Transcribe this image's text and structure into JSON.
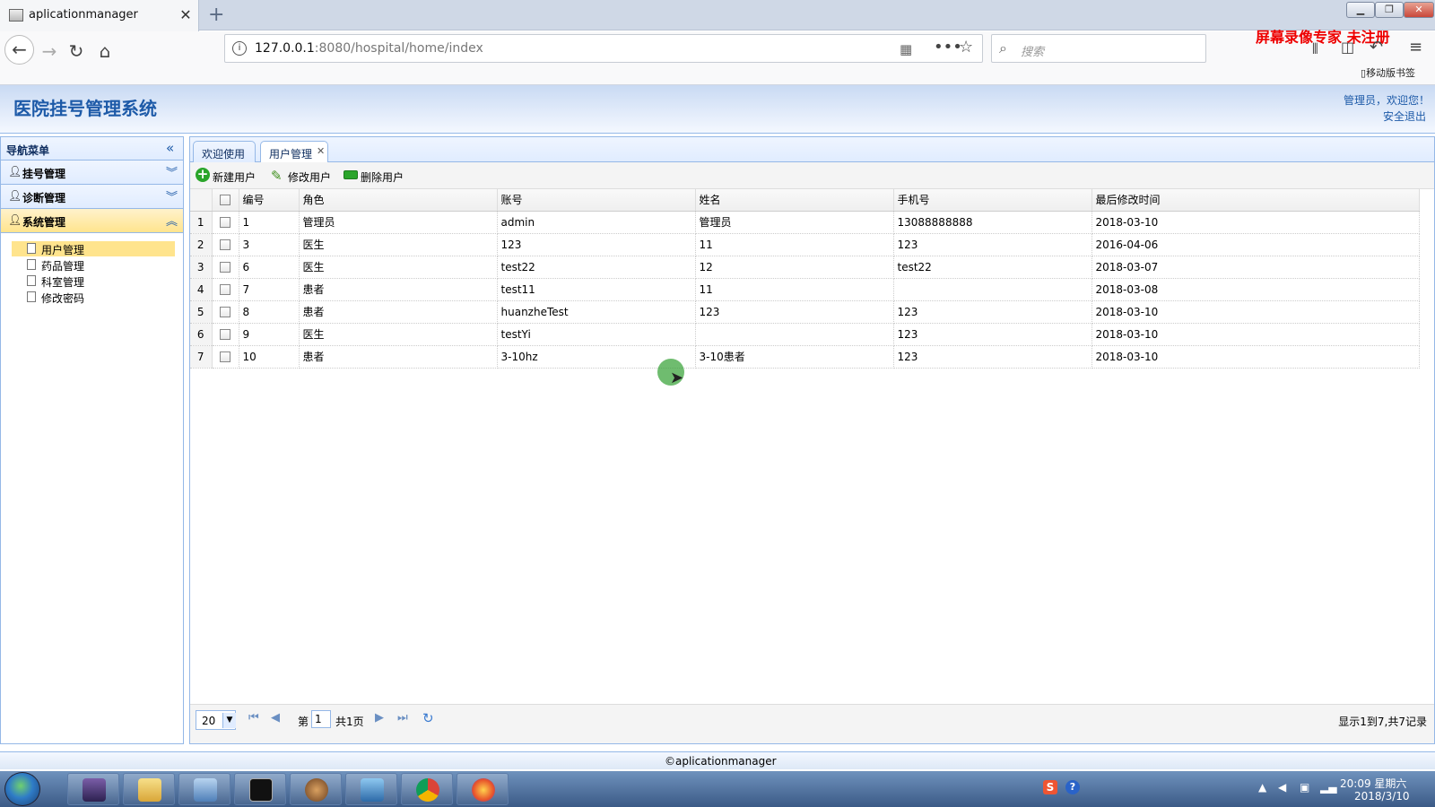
{
  "browser": {
    "tab_title": "aplicationmanager",
    "url_host": "127.0.0.1",
    "url_rest": ":8080/hospital/home/index",
    "search_placeholder": "搜索",
    "watermark": "屏幕录像专家 未注册",
    "mobile_bookmarks": "移动版书签"
  },
  "header": {
    "title": "医院挂号管理系统",
    "welcome": "管理员，欢迎您！",
    "logout": "安全退出"
  },
  "nav": {
    "title": "导航菜单",
    "groups": [
      {
        "label": "挂号管理"
      },
      {
        "label": "诊断管理"
      },
      {
        "label": "系统管理"
      }
    ],
    "sub_items": [
      {
        "label": "用户管理"
      },
      {
        "label": "药品管理"
      },
      {
        "label": "科室管理"
      },
      {
        "label": "修改密码"
      }
    ]
  },
  "tabs": [
    {
      "label": "欢迎使用"
    },
    {
      "label": "用户管理"
    }
  ],
  "toolbar": {
    "new": "新建用户",
    "edit": "修改用户",
    "delete": "删除用户"
  },
  "grid": {
    "columns": [
      "编号",
      "角色",
      "账号",
      "姓名",
      "手机号",
      "最后修改时间"
    ],
    "rows": [
      [
        "1",
        "1",
        "管理员",
        "admin",
        "管理员",
        "13088888888",
        "2018-03-10"
      ],
      [
        "2",
        "3",
        "医生",
        "123",
        "11",
        "123",
        "2016-04-06"
      ],
      [
        "3",
        "6",
        "医生",
        "test22",
        "12",
        "test22",
        "2018-03-07"
      ],
      [
        "4",
        "7",
        "患者",
        "test11",
        "11",
        "",
        "2018-03-08"
      ],
      [
        "5",
        "8",
        "患者",
        "huanzheTest",
        "123",
        "123",
        "2018-03-10"
      ],
      [
        "6",
        "9",
        "医生",
        "testYi",
        "",
        "123",
        "2018-03-10"
      ],
      [
        "7",
        "10",
        "患者",
        "3-10hz",
        "3-10患者",
        "123",
        "2018-03-10"
      ]
    ]
  },
  "pager": {
    "page_size": "20",
    "page_prefix": "第",
    "page_current": "1",
    "page_total": "共1页",
    "info": "显示1到7,共7记录"
  },
  "footer": {
    "text": "©aplicationmanager"
  },
  "taskbar": {
    "time": "20:09 星期六",
    "date": "2018/3/10"
  }
}
